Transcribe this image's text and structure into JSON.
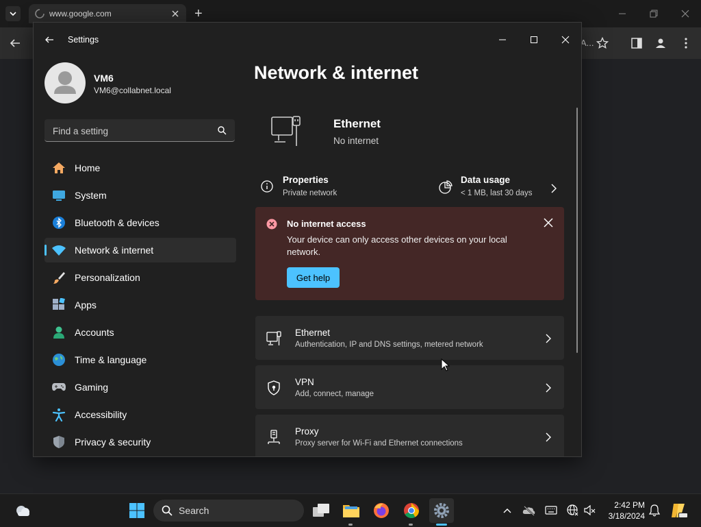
{
  "browser": {
    "tab_title": "www.google.com",
    "new_tab": "+",
    "address_fragment": "A..."
  },
  "settings": {
    "window_title": "Settings",
    "user": {
      "name": "VM6",
      "email": "VM6@collabnet.local"
    },
    "search_placeholder": "Find a setting",
    "nav": [
      {
        "label": "Home",
        "icon": "home-icon"
      },
      {
        "label": "System",
        "icon": "system-icon"
      },
      {
        "label": "Bluetooth & devices",
        "icon": "bluetooth-icon"
      },
      {
        "label": "Network & internet",
        "icon": "wifi-icon",
        "active": true
      },
      {
        "label": "Personalization",
        "icon": "brush-icon"
      },
      {
        "label": "Apps",
        "icon": "apps-icon"
      },
      {
        "label": "Accounts",
        "icon": "accounts-icon"
      },
      {
        "label": "Time & language",
        "icon": "globe-icon"
      },
      {
        "label": "Gaming",
        "icon": "gamepad-icon"
      },
      {
        "label": "Accessibility",
        "icon": "accessibility-icon"
      },
      {
        "label": "Privacy & security",
        "icon": "shield-icon"
      }
    ],
    "page_title": "Network & internet",
    "connection": {
      "name": "Ethernet",
      "status": "No internet"
    },
    "properties": {
      "title": "Properties",
      "subtitle": "Private network"
    },
    "data_usage": {
      "title": "Data usage",
      "subtitle": "< 1 MB, last 30 days"
    },
    "banner": {
      "title": "No internet access",
      "message": "Your device can only access other devices on your local network.",
      "button": "Get help"
    },
    "cards": [
      {
        "title": "Ethernet",
        "subtitle": "Authentication, IP and DNS settings, metered network",
        "icon": "ethernet-icon"
      },
      {
        "title": "VPN",
        "subtitle": "Add, connect, manage",
        "icon": "vpn-shield-icon"
      },
      {
        "title": "Proxy",
        "subtitle": "Proxy server for Wi-Fi and Ethernet connections",
        "icon": "proxy-icon"
      }
    ]
  },
  "taskbar": {
    "search_label": "Search",
    "time": "2:42 PM",
    "date": "3/18/2024"
  },
  "colors": {
    "accent": "#4cc2ff",
    "banner_bg": "#442726",
    "error": "#ff99a4"
  }
}
